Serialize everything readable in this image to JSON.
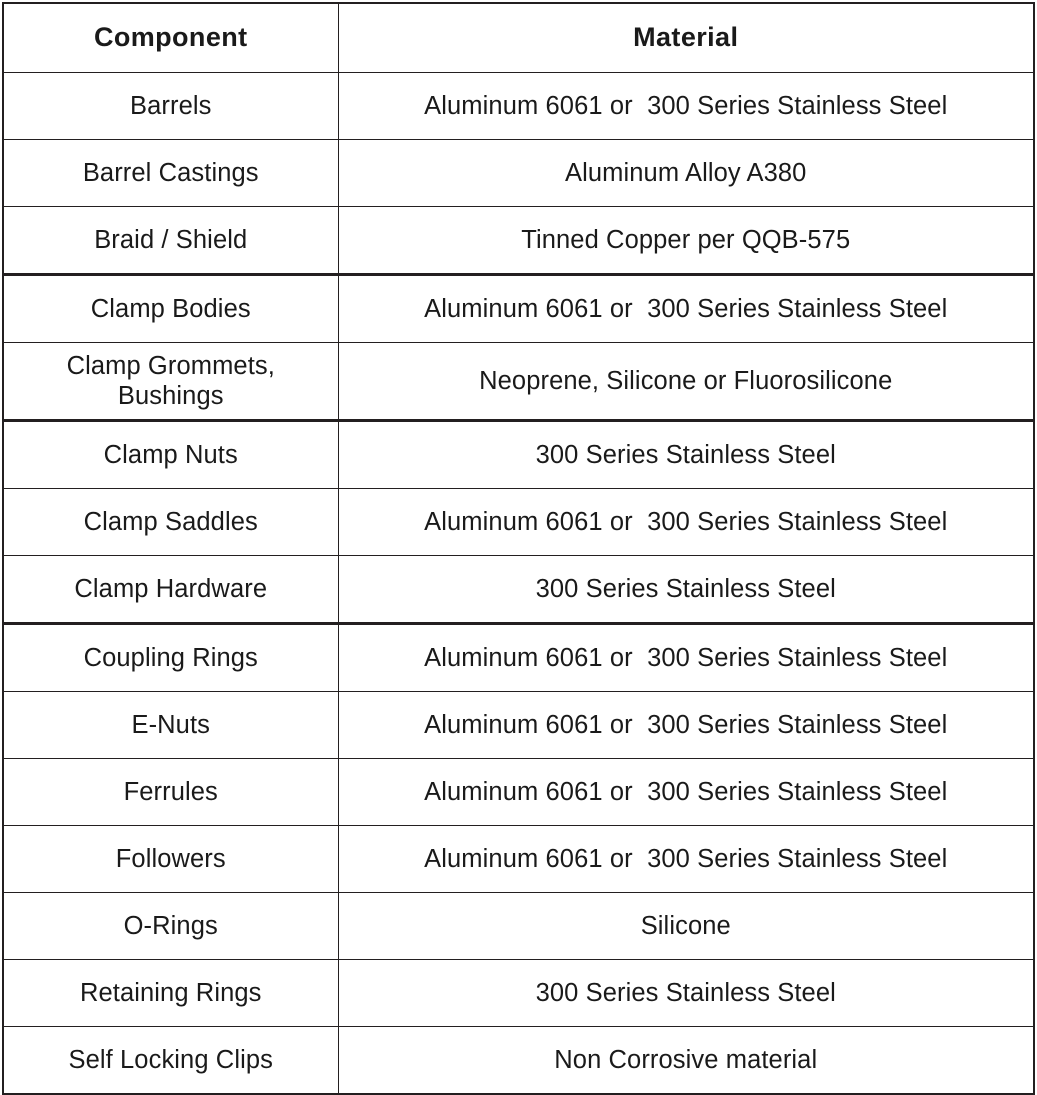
{
  "table": {
    "name": "component-material-specification-table",
    "columns": [
      {
        "key": "component",
        "label": "Component"
      },
      {
        "key": "material",
        "label": "Material"
      }
    ],
    "rows": [
      {
        "component": "Barrels",
        "material": "Aluminum 6061 or  300 Series Stainless Steel",
        "heavy_top": false,
        "tall": false
      },
      {
        "component": "Barrel Castings",
        "material": "Aluminum Alloy A380",
        "heavy_top": false,
        "tall": false
      },
      {
        "component": "Braid / Shield",
        "material": "Tinned Copper per QQB-575",
        "heavy_top": false,
        "tall": false
      },
      {
        "component": "Clamp Bodies",
        "material": "Aluminum 6061 or  300 Series Stainless Steel",
        "heavy_top": true,
        "tall": false
      },
      {
        "component": "Clamp Grommets,\nBushings",
        "material": "Neoprene, Silicone or Fluorosilicone",
        "heavy_top": false,
        "tall": true
      },
      {
        "component": "Clamp Nuts",
        "material": "300 Series Stainless Steel",
        "heavy_top": true,
        "tall": false
      },
      {
        "component": "Clamp Saddles",
        "material": "Aluminum 6061 or  300 Series Stainless Steel",
        "heavy_top": false,
        "tall": false
      },
      {
        "component": "Clamp Hardware",
        "material": "300 Series Stainless Steel",
        "heavy_top": false,
        "tall": false
      },
      {
        "component": "Coupling Rings",
        "material": "Aluminum 6061 or  300 Series Stainless Steel",
        "heavy_top": true,
        "tall": false
      },
      {
        "component": "E-Nuts",
        "material": "Aluminum 6061 or  300 Series Stainless Steel",
        "heavy_top": false,
        "tall": false
      },
      {
        "component": "Ferrules",
        "material": "Aluminum 6061 or  300 Series Stainless Steel",
        "heavy_top": false,
        "tall": false
      },
      {
        "component": "Followers",
        "material": "Aluminum 6061 or  300 Series Stainless Steel",
        "heavy_top": false,
        "tall": false
      },
      {
        "component": "O-Rings",
        "material": "Silicone",
        "heavy_top": false,
        "tall": false
      },
      {
        "component": "Retaining Rings",
        "material": "300 Series Stainless Steel",
        "heavy_top": false,
        "tall": false
      },
      {
        "component": "Self Locking Clips",
        "material": "Non Corrosive material",
        "heavy_top": false,
        "tall": false
      }
    ]
  },
  "style": {
    "border_color": "#231f20",
    "text_color": "#1a1a1a",
    "background": "#ffffff"
  }
}
